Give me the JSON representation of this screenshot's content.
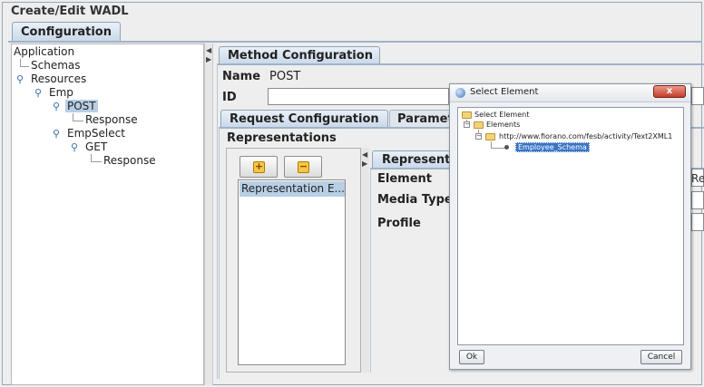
{
  "window": {
    "title": "Create/Edit WADL"
  },
  "tabs": {
    "configuration": "Configuration"
  },
  "tree": {
    "application": "Application",
    "schemas": "Schemas",
    "resources": "Resources",
    "emp": "Emp",
    "post": "POST",
    "post_response": "Response",
    "empselect": "EmpSelect",
    "get": "GET",
    "get_response": "Response"
  },
  "method_config": {
    "tab_label": "Method Configuration",
    "name_label": "Name",
    "name_value": "POST",
    "id_label": "ID",
    "id_value": ""
  },
  "request_tabs": {
    "request": "Request Configuration",
    "parameters": "Paramet"
  },
  "representations": {
    "section_label": "Representations",
    "list_items": [
      "Representation E..."
    ],
    "tab_label": "Represent",
    "element_label": "Element",
    "media_type_label": "Media Type",
    "profile_label": "Profile",
    "clipped_value": "/Re"
  },
  "dialog": {
    "title": "Select Element",
    "close_symbol": "x",
    "tree": {
      "root": "Select Element",
      "elements": "Elements",
      "namespace": "http://www.fiorano.com/fesb/activity/Text2XML1",
      "leaf": "Employee_Schema"
    },
    "ok_label": "Ok",
    "cancel_label": "Cancel"
  },
  "colors": {
    "tab_gradient_top": "#e9f0f8",
    "tab_gradient_bottom": "#c9d8e8",
    "selection": "#b8cfe5",
    "dialog_selection": "#3a75c4",
    "close_button": "#c43c2a"
  }
}
